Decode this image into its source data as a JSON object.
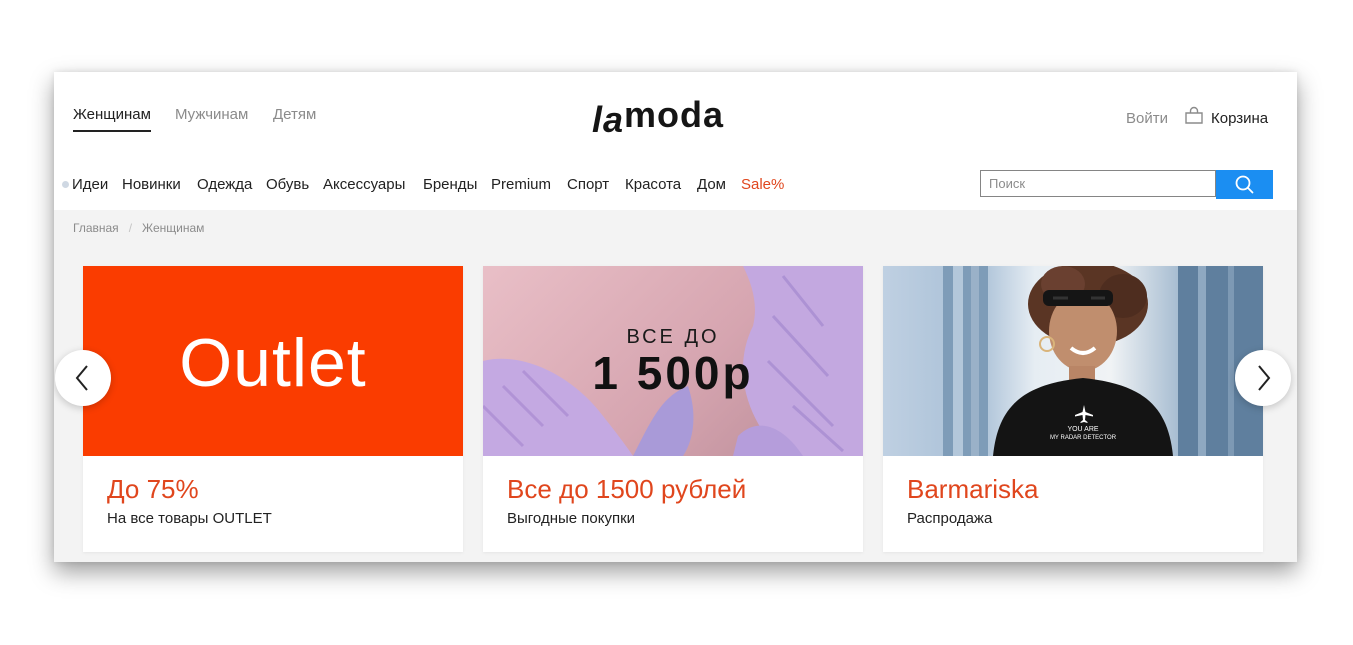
{
  "header": {
    "genders": [
      "Женщинам",
      "Мужчинам",
      "Детям"
    ],
    "logo": {
      "prefix": "la",
      "rest": "moda"
    },
    "login": "Войти",
    "cart": "Корзина"
  },
  "menu": [
    "Идеи",
    "Новинки",
    "Одежда",
    "Обувь",
    "Аксессуары",
    "Бренды",
    "Premium",
    "Спорт",
    "Красота",
    "Дом",
    "Sale%"
  ],
  "search": {
    "placeholder": "Поиск"
  },
  "breadcrumb": [
    "Главная",
    "Женщинам"
  ],
  "cards": [
    {
      "banner": "Outlet",
      "title": "До 75%",
      "subtitle": "На все товары OUTLET"
    },
    {
      "banner_top": "ВСЕ ДО",
      "banner_price": "1 500р",
      "title": "Все до 1500 рублей",
      "subtitle": "Выгодные покупки"
    },
    {
      "shirt_line1": "YOU ARE",
      "shirt_line2": "MY RADAR DETECTOR",
      "title": "Barmariska",
      "subtitle": "Распродажа"
    }
  ],
  "colors": {
    "accent": "#e0461d",
    "search_button": "#1b8ef2",
    "outlet_bg": "#fa3c00"
  },
  "icons": [
    "cart-icon",
    "search-icon",
    "chevron-left-icon",
    "chevron-right-icon",
    "airplane-icon"
  ]
}
